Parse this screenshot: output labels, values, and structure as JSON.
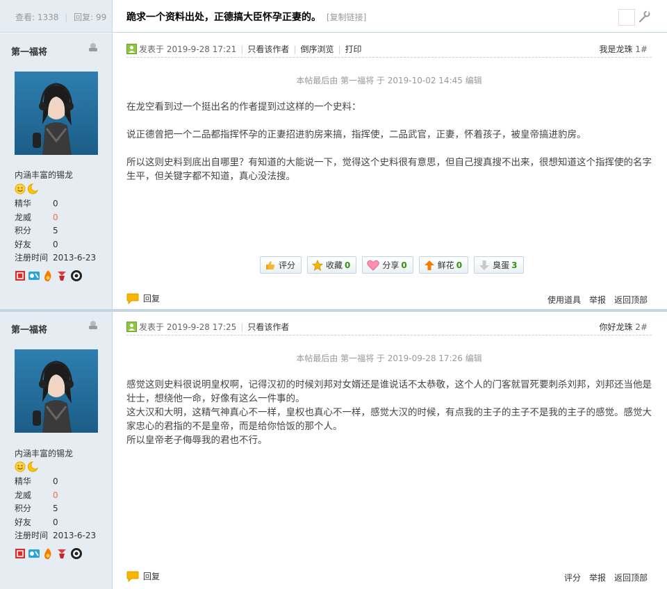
{
  "header": {
    "views_label": "查看:",
    "views": "1338",
    "replies_label": "回复:",
    "replies": "99",
    "title": "跪求一个资料出处，正德搞大臣怀孕正妻的。",
    "copy_link": "[复制链接]"
  },
  "posts": [
    {
      "author": "第一福将",
      "rank": "内涵丰富的锡龙",
      "stats": [
        {
          "k": "精华",
          "v": "0"
        },
        {
          "k": "龙威",
          "v": "0"
        },
        {
          "k": "积分",
          "v": "5"
        },
        {
          "k": "好友",
          "v": "0"
        },
        {
          "k": "注册时间",
          "v": "2013-6-23"
        }
      ],
      "posted": "发表于 2019-9-28 17:21",
      "only_author": "只看该作者",
      "reverse": "倒序浏览",
      "print": "打印",
      "floor_label": "我是龙珠",
      "floor": "1#",
      "edited": "本帖最后由 第一福将 于 2019-10-02 14:45 编辑",
      "paragraphs": [
        "在龙空看到过一个挺出名的作者提到过这样的一个史料：",
        "说正德曾把一个二品都指挥怀孕的正妻招进豹房来搞，指挥使，二品武官，正妻，怀着孩子，被皇帝搞进豹房。",
        "所以这则史料到底出自哪里？有知道的大能说一下，觉得这个史料很有意思，但自己搜真搜不出来，很想知道这个指挥使的名字生平，但关键字都不知道，真心没法搜。"
      ],
      "actions": {
        "rate": "评分",
        "fav": "收藏",
        "fav_count": "0",
        "share": "分享",
        "share_count": "0",
        "flower": "鲜花",
        "flower_count": "0",
        "egg": "臭蛋",
        "egg_count": "3"
      },
      "reply": "回复",
      "foot_links": [
        "使用道具",
        "举报",
        "返回顶部"
      ]
    },
    {
      "author": "第一福将",
      "rank": "内涵丰富的锡龙",
      "stats": [
        {
          "k": "精华",
          "v": "0"
        },
        {
          "k": "龙威",
          "v": "0"
        },
        {
          "k": "积分",
          "v": "5"
        },
        {
          "k": "好友",
          "v": "0"
        },
        {
          "k": "注册时间",
          "v": "2013-6-23"
        }
      ],
      "posted": "发表于 2019-9-28 17:25",
      "only_author": "只看该作者",
      "floor_label": "你好龙珠",
      "floor": "2#",
      "edited": "本帖最后由 第一福将 于 2019-09-28 17:26 编辑",
      "paragraphs": [
        "感觉这则史料很说明皇权啊，记得汉初的时候刘邦对女婿还是谁说话不太恭敬，这个人的门客就冒死要刺杀刘邦，刘邦还当他是壮士，想绕他一命，好像有这么一件事的。",
        "这大汉和大明，这精气神真心不一样，皇权也真心不一样，感觉大汉的时候，有点我的主子的主子不是我的主子的感觉。感觉大家忠心的君指的不是皇帝，而是给你恰饭的那个人。",
        "所以皇帝老子侮辱我的君也不行。"
      ],
      "reply": "回复",
      "foot_links": [
        "评分",
        "举报",
        "返回顶部"
      ]
    }
  ],
  "colors": {
    "side_bg": "#e5edf2",
    "border": "#c2d5e3",
    "count_green": "#369309",
    "red_value": "#f26c4f"
  }
}
